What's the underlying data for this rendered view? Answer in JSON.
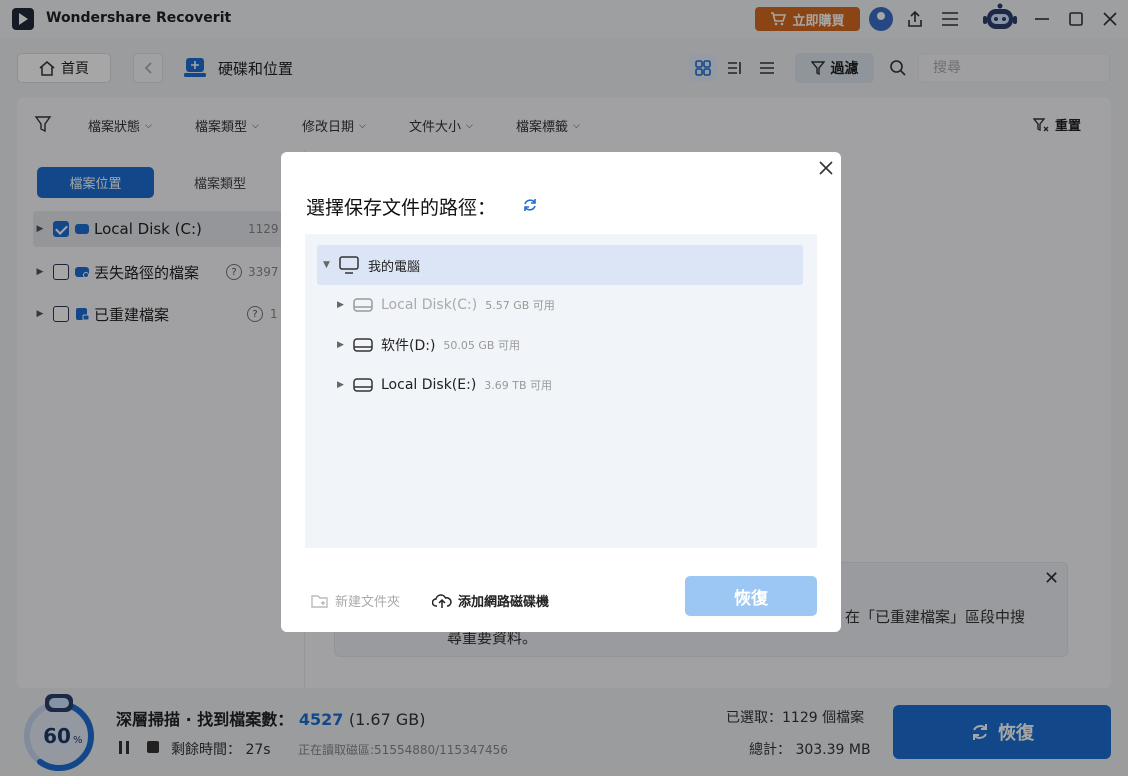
{
  "app": {
    "title": "Wondershare Recoverit",
    "buy_label": "立即購買"
  },
  "toolbar": {
    "home_label": "首頁",
    "breadcrumb": "硬碟和位置",
    "filter_label": "過濾",
    "search_placeholder": "搜尋"
  },
  "filters": {
    "items": [
      "檔案狀態",
      "檔案類型",
      "修改日期",
      "文件大小",
      "檔案標籤"
    ],
    "reset_label": "重置"
  },
  "sidebar": {
    "tabs": [
      "檔案位置",
      "檔案類型"
    ],
    "items": [
      {
        "label": "Local Disk (C:)",
        "count": "1129",
        "checked": true
      },
      {
        "label": "丟失路徑的檔案",
        "count": "3397",
        "checked": false
      },
      {
        "label": "已重建檔案",
        "count": "1",
        "checked": false
      }
    ]
  },
  "notice": {
    "line1": "在「已重建檔案」區段中搜",
    "line2": "尋重要資料。"
  },
  "modal": {
    "title": "選擇保存文件的路徑：",
    "root": "我的電腦",
    "drives": [
      {
        "name": "Local Disk(C:)",
        "free": "5.57 GB 可用",
        "disabled": true
      },
      {
        "name": "软件(D:)",
        "free": "50.05 GB 可用",
        "disabled": false
      },
      {
        "name": "Local Disk(E:)",
        "free": "3.69 TB 可用",
        "disabled": false
      }
    ],
    "new_folder": "新建文件夾",
    "add_network": "添加網路磁碟機",
    "recover": "恢復"
  },
  "status": {
    "progress_percent": 60,
    "progress_num": "60",
    "progress_unit": "%",
    "scan_prefix": "深層掃描 · 找到檔案數：",
    "found_count": "4527",
    "found_size": "(1.67 GB)",
    "remaining": "剩餘時間： 27s",
    "sector": "正在讀取磁區:51554880/115347456",
    "selected": "已選取：1129 個檔案",
    "total": "總計： 303.39 MB",
    "recover_label": "恢復"
  },
  "colors": {
    "accent": "#1d6fd4",
    "buy": "#d66a20",
    "modal_btn": "#9cc6f4"
  }
}
